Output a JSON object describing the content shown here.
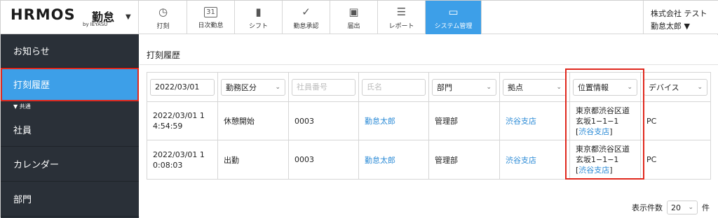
{
  "brand": {
    "logo": "HRMOS",
    "product": "勤怠",
    "by": "by IEYASU",
    "caret": "▼"
  },
  "nav": [
    {
      "label": "打刻",
      "icon": "◷"
    },
    {
      "label": "日次勤怠",
      "icon": "31"
    },
    {
      "label": "シフト",
      "icon": "▮"
    },
    {
      "label": "勤怠承認",
      "icon": "✓"
    },
    {
      "label": "届出",
      "icon": "▣"
    },
    {
      "label": "レポート",
      "icon": "☰"
    },
    {
      "label": "システム管理",
      "icon": "▭"
    }
  ],
  "company": {
    "name": "株式会社 テスト",
    "user": "勤怠太郎 ▼"
  },
  "sidebar": {
    "items": [
      {
        "label": "お知らせ"
      },
      {
        "label": "打刻履歴"
      },
      {
        "label": "社員"
      },
      {
        "label": "カレンダー"
      },
      {
        "label": "部門"
      }
    ],
    "section": "▼ 共通"
  },
  "main": {
    "title": "打刻履歴"
  },
  "filters": {
    "date": "2022/03/01",
    "kubun": "勤務区分",
    "emp_no_placeholder": "社員番号",
    "name_placeholder": "氏名",
    "dept": "部門",
    "base": "拠点",
    "location": "位置情報",
    "device": "デバイス"
  },
  "rows": [
    {
      "datetime_line1": "2022/03/01 1",
      "datetime_line2": "4:54:59",
      "kubun": "休憩開始",
      "emp_no": "0003",
      "name": "勤怠太郎",
      "dept": "管理部",
      "base": "渋谷支店",
      "loc_line1": "東京都渋谷区道",
      "loc_line2": "玄坂1−1−1",
      "loc_link": "渋谷支店",
      "device": "PC"
    },
    {
      "datetime_line1": "2022/03/01 1",
      "datetime_line2": "0:08:03",
      "kubun": "出勤",
      "emp_no": "0003",
      "name": "勤怠太郎",
      "dept": "管理部",
      "base": "渋谷支店",
      "loc_line1": "東京都渋谷区道",
      "loc_line2": "玄坂1−1−1",
      "loc_link": "渋谷支店",
      "device": "PC"
    }
  ],
  "footer": {
    "label": "表示件数",
    "value": "20",
    "unit": "件"
  },
  "colors": {
    "accent": "#3d9fe8",
    "sidebar": "#2a3038",
    "highlight": "#e0281d",
    "link": "#2a8ad6"
  }
}
